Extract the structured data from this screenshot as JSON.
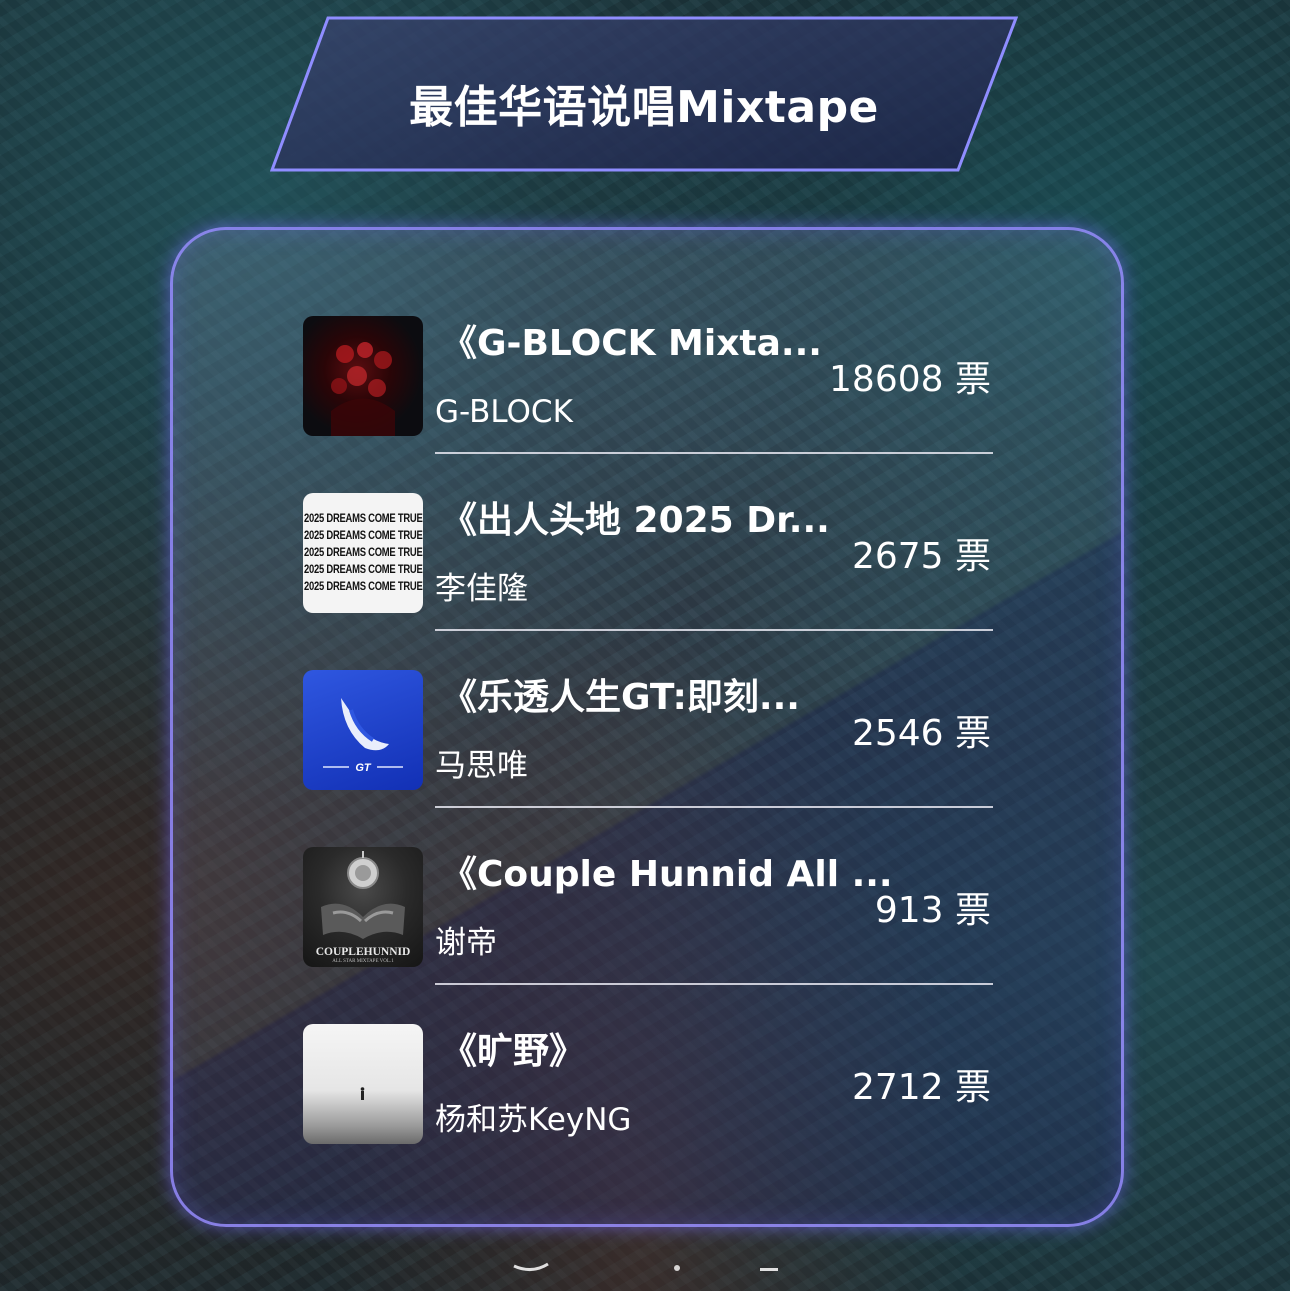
{
  "banner": {
    "title": "最佳华语说唱Mixtape"
  },
  "entries": [
    {
      "title": "《G-BLOCK Mixta...",
      "artist": "G-BLOCK",
      "votes": "18608 票",
      "cover_icon": "album-cover-g-block"
    },
    {
      "title": "《出人头地 2025 Dr...",
      "artist": "李佳隆",
      "votes": "2675 票",
      "cover_icon": "album-cover-dreams-come-true",
      "cover_lines": [
        "2025 DREAMS COME TRUE",
        "2025 DREAMS COME TRUE",
        "2025 DREAMS COME TRUE",
        "2025 DREAMS COME TRUE",
        "2025 DREAMS COME TRUE"
      ]
    },
    {
      "title": "《乐透人生GT:即刻...",
      "artist": "马思唯",
      "votes": "2546 票",
      "cover_icon": "album-cover-gt",
      "cover_text": "GT"
    },
    {
      "title": "《Couple Hunnid All ...",
      "artist": "谢帝",
      "votes": "913 票",
      "cover_icon": "album-cover-couplehunnid",
      "cover_text": "COUPLEHUNNID",
      "cover_subtext": "ALL STAR MIXTAPE VOL.1"
    },
    {
      "title": "《旷野》",
      "artist": "杨和苏KeyNG",
      "votes": "2712 票",
      "cover_icon": "album-cover-wilderness"
    }
  ],
  "colors": {
    "card_border": "#968cff",
    "text": "#ffffff",
    "banner_border": "#8f8dff"
  }
}
